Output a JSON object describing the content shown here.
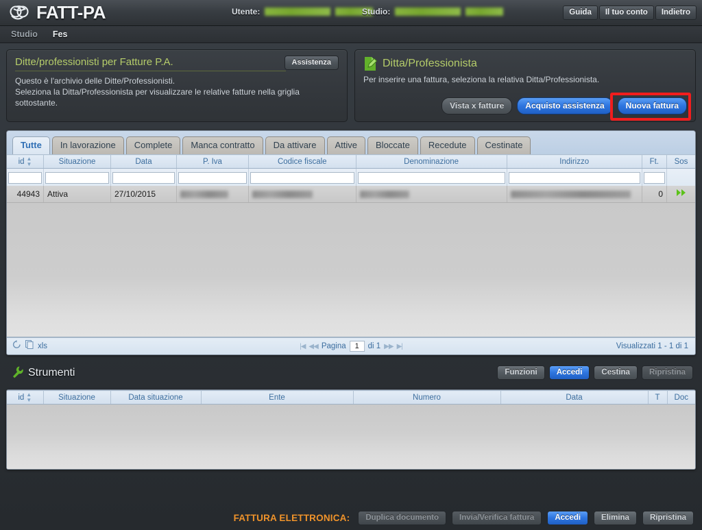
{
  "header": {
    "brand": "FATT-PA",
    "logo_icon": "knot-logo-icon",
    "utente_label": "Utente:",
    "studio_label": "Studio:",
    "buttons": [
      {
        "label": "Guida",
        "name": "guida-button"
      },
      {
        "label": "Il tuo conto",
        "name": "il-tuo-conto-button"
      },
      {
        "label": "Indietro",
        "name": "indietro-button"
      }
    ]
  },
  "nav": {
    "items": [
      {
        "label": "Studio",
        "active": false
      },
      {
        "label": "Fes",
        "active": true
      }
    ]
  },
  "left_panel": {
    "title": "Ditte/professionisti per Fatture P.A.",
    "assistenza_label": "Assistenza",
    "desc_line1": "Questo è l'archivio delle Ditte/Professionisti.",
    "desc_line2": "Seleziona la Ditta/Professionista per visualizzare le relative fatture nella griglia",
    "desc_line3": "sottostante."
  },
  "right_panel": {
    "icon": "document-pencil-icon",
    "title": "Ditta/Professionista",
    "desc": "Per inserire una fattura, seleziona la relativa Ditta/Professionista.",
    "buttons": [
      {
        "label": "Vista x fatture",
        "name": "vista-x-fatture-button",
        "style": "grey"
      },
      {
        "label": "Acquisto assistenza",
        "name": "acquisto-assistenza-button",
        "style": "blue"
      },
      {
        "label": "Nuova fattura",
        "name": "nuova-fattura-button",
        "style": "blue",
        "highlighted": true
      }
    ],
    "highlight_color": "#f21d1d"
  },
  "tabs": [
    {
      "label": "Tutte",
      "active": true
    },
    {
      "label": "In lavorazione",
      "active": false
    },
    {
      "label": "Complete",
      "active": false
    },
    {
      "label": "Manca contratto",
      "active": false
    },
    {
      "label": "Da attivare",
      "active": false
    },
    {
      "label": "Attive",
      "active": false
    },
    {
      "label": "Bloccate",
      "active": false
    },
    {
      "label": "Recedute",
      "active": false
    },
    {
      "label": "Cestinate",
      "active": false
    }
  ],
  "grid1": {
    "columns": [
      {
        "label": "id",
        "sortable": true
      },
      {
        "label": "Situazione",
        "sortable": false
      },
      {
        "label": "Data",
        "sortable": false
      },
      {
        "label": "P. Iva",
        "sortable": false
      },
      {
        "label": "Codice fiscale",
        "sortable": false
      },
      {
        "label": "Denominazione",
        "sortable": false
      },
      {
        "label": "Indirizzo",
        "sortable": false
      },
      {
        "label": "Ft.",
        "sortable": false
      },
      {
        "label": "Sos",
        "sortable": false
      }
    ],
    "filters": [
      "",
      "",
      "",
      "",
      "",
      "",
      "",
      ""
    ],
    "rows": [
      {
        "id": "44943",
        "situazione": "Attiva",
        "data": "27/10/2015",
        "p_iva": "",
        "codice_fiscale": "",
        "denominazione": "",
        "indirizzo": "",
        "ft": "0",
        "sos_icon": "green-double-arrow-icon"
      }
    ],
    "footer": {
      "refresh_icon": "refresh-icon",
      "xls_icon": "xls-export-icon",
      "xls_label": "xls",
      "first_icon": "first-page-icon",
      "prev_icon": "prev-page-icon",
      "page_label": "Pagina",
      "page_value": "1",
      "of_label": "di 1",
      "next_icon": "next-page-icon",
      "last_icon": "last-page-icon",
      "count_label": "Visualizzati 1 - 1 di 1"
    }
  },
  "strumenti": {
    "icon": "wrench-icon",
    "title": "Strumenti",
    "buttons": [
      {
        "label": "Funzioni",
        "name": "funzioni-button",
        "style": "grey"
      },
      {
        "label": "Accedi",
        "name": "accedi-button",
        "style": "blue"
      },
      {
        "label": "Cestina",
        "name": "cestina-button",
        "style": "grey"
      },
      {
        "label": "Ripristina",
        "name": "ripristina-button",
        "style": "disabled"
      }
    ]
  },
  "grid2": {
    "columns": [
      {
        "label": "id",
        "sortable": true
      },
      {
        "label": "Situazione",
        "sortable": false
      },
      {
        "label": "Data situazione",
        "sortable": false
      },
      {
        "label": "Ente",
        "sortable": false
      },
      {
        "label": "Numero",
        "sortable": false
      },
      {
        "label": "Data",
        "sortable": false
      },
      {
        "label": "T",
        "sortable": false
      },
      {
        "label": "Doc",
        "sortable": false
      }
    ],
    "rows": []
  },
  "footer": {
    "label": "FATTURA ELETTRONICA:",
    "label_color": "#f0932a",
    "buttons": [
      {
        "label": "Duplica documento",
        "name": "duplica-documento-button",
        "style": "disabled"
      },
      {
        "label": "Invia/Verifica fattura",
        "name": "invia-verifica-fattura-button",
        "style": "disabled"
      },
      {
        "label": "Accedi",
        "name": "footer-accedi-button",
        "style": "blue"
      },
      {
        "label": "Elimina",
        "name": "elimina-button",
        "style": "grey"
      },
      {
        "label": "Ripristina",
        "name": "footer-ripristina-button",
        "style": "grey"
      }
    ]
  }
}
